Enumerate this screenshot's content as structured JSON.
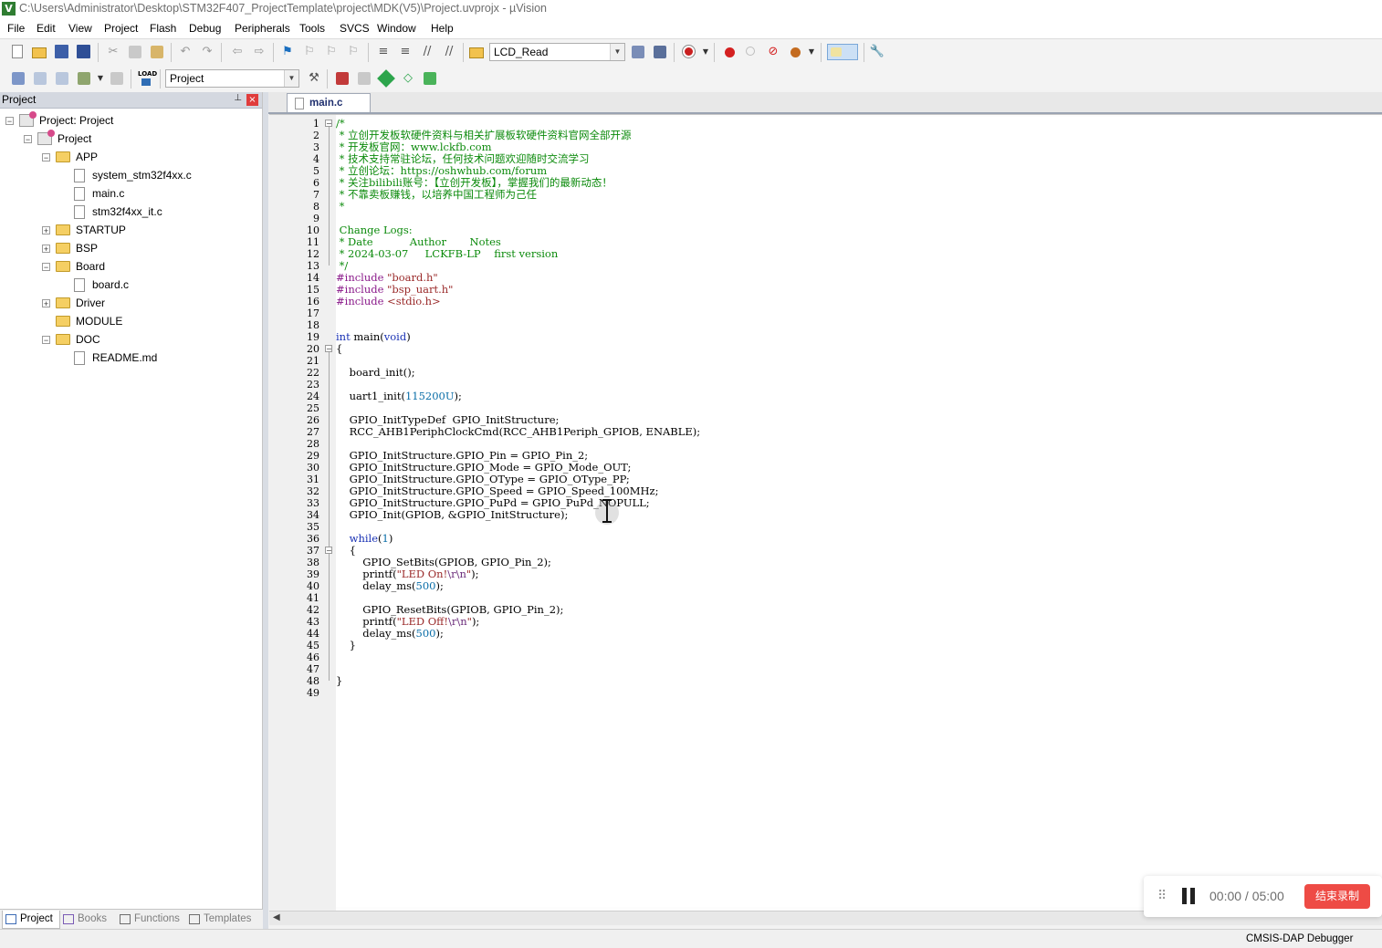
{
  "window": {
    "title": "C:\\Users\\Administrator\\Desktop\\STM32F407_ProjectTemplate\\project\\MDK(V5)\\Project.uvprojx - µVision",
    "app_icon_letter": "V"
  },
  "menu": [
    "File",
    "Edit",
    "View",
    "Project",
    "Flash",
    "Debug",
    "Peripherals",
    "Tools",
    "SVCS",
    "Window",
    "Help"
  ],
  "toolbar1": {
    "find_combo_value": "LCD_Read"
  },
  "toolbar2": {
    "load_label": "LOAD",
    "target_combo_value": "Project"
  },
  "project_panel": {
    "title": "Project",
    "pin_glyph": "⊥",
    "close_glyph": "×",
    "tree": [
      {
        "label": "Project: Project",
        "toggle": "−",
        "icon": "project-root-icon"
      },
      {
        "label": "Project",
        "toggle": "−",
        "icon": "target-folder-icon"
      },
      {
        "label": "APP",
        "toggle": "−",
        "icon": "folder-icon"
      },
      {
        "label": "system_stm32f4xx.c",
        "toggle": "",
        "icon": "file-icon"
      },
      {
        "label": "main.c",
        "toggle": "",
        "icon": "file-icon"
      },
      {
        "label": "stm32f4xx_it.c",
        "toggle": "",
        "icon": "file-icon"
      },
      {
        "label": "STARTUP",
        "toggle": "+",
        "icon": "folder-icon"
      },
      {
        "label": "BSP",
        "toggle": "+",
        "icon": "folder-icon"
      },
      {
        "label": "Board",
        "toggle": "−",
        "icon": "folder-icon"
      },
      {
        "label": "board.c",
        "toggle": "",
        "icon": "file-icon"
      },
      {
        "label": "Driver",
        "toggle": "+",
        "icon": "folder-icon"
      },
      {
        "label": "MODULE",
        "toggle": "",
        "icon": "folder-icon"
      },
      {
        "label": "DOC",
        "toggle": "−",
        "icon": "folder-icon"
      },
      {
        "label": "README.md",
        "toggle": "",
        "icon": "file-icon"
      }
    ],
    "tabs": [
      "Project",
      "Books",
      "Functions",
      "Templates"
    ],
    "tab_icons": [
      "project-tab-icon",
      "books-tab-icon",
      "functions-tab-icon",
      "templates-tab-icon"
    ],
    "active_tab": "Project"
  },
  "editor": {
    "active_tab": "main.c",
    "lines": [
      "/*",
      " * 立创开发板软硬件资料与相关扩展板软硬件资料官网全部开源",
      " * 开发板官网：www.lckfb.com",
      " * 技术支持常驻论坛，任何技术问题欢迎随时交流学习",
      " * 立创论坛：https://oshwhub.com/forum",
      " * 关注bilibili账号：【立创开发板】，掌握我们的最新动态！",
      " * 不靠卖板赚钱，以培养中国工程师为己任",
      " *",
      "",
      " Change Logs:",
      " * Date           Author       Notes",
      " * 2024-03-07     LCKFB-LP    first version",
      " */",
      "#include \"board.h\"",
      "#include \"bsp_uart.h\"",
      "#include <stdio.h>",
      "",
      "",
      "int main(void)",
      "{",
      "",
      "    board_init();",
      "",
      "    uart1_init(115200U);",
      "",
      "    GPIO_InitTypeDef  GPIO_InitStructure;",
      "    RCC_AHB1PeriphClockCmd(RCC_AHB1Periph_GPIOB, ENABLE);",
      "",
      "    GPIO_InitStructure.GPIO_Pin = GPIO_Pin_2;",
      "    GPIO_InitStructure.GPIO_Mode = GPIO_Mode_OUT;",
      "    GPIO_InitStructure.GPIO_OType = GPIO_OType_PP;",
      "    GPIO_InitStructure.GPIO_Speed = GPIO_Speed_100MHz;",
      "    GPIO_InitStructure.GPIO_PuPd = GPIO_PuPd_NOPULL;",
      "    GPIO_Init(GPIOB, &GPIO_InitStructure);",
      "",
      "    while(1)",
      "    {",
      "        GPIO_SetBits(GPIOB, GPIO_Pin_2);",
      "        printf(\"LED On!\\r\\n\");",
      "        delay_ms(500);",
      "",
      "        GPIO_ResetBits(GPIOB, GPIO_Pin_2);",
      "        printf(\"LED Off!\\r\\n\");",
      "        delay_ms(500);",
      "    }",
      "",
      "",
      "}",
      ""
    ]
  },
  "statusbar": {
    "debugger": "CMSIS-DAP Debugger"
  },
  "recorder": {
    "time": "00:00 / 05:00",
    "stop_label": "结束录制",
    "accent": "#ee4b45"
  },
  "colors": {
    "comment": "#0b8a0b",
    "preprocessor": "#8a1a8a",
    "string": "#9a2a2a",
    "keyword": "#1a32b4",
    "number": "#0b6ea8"
  }
}
